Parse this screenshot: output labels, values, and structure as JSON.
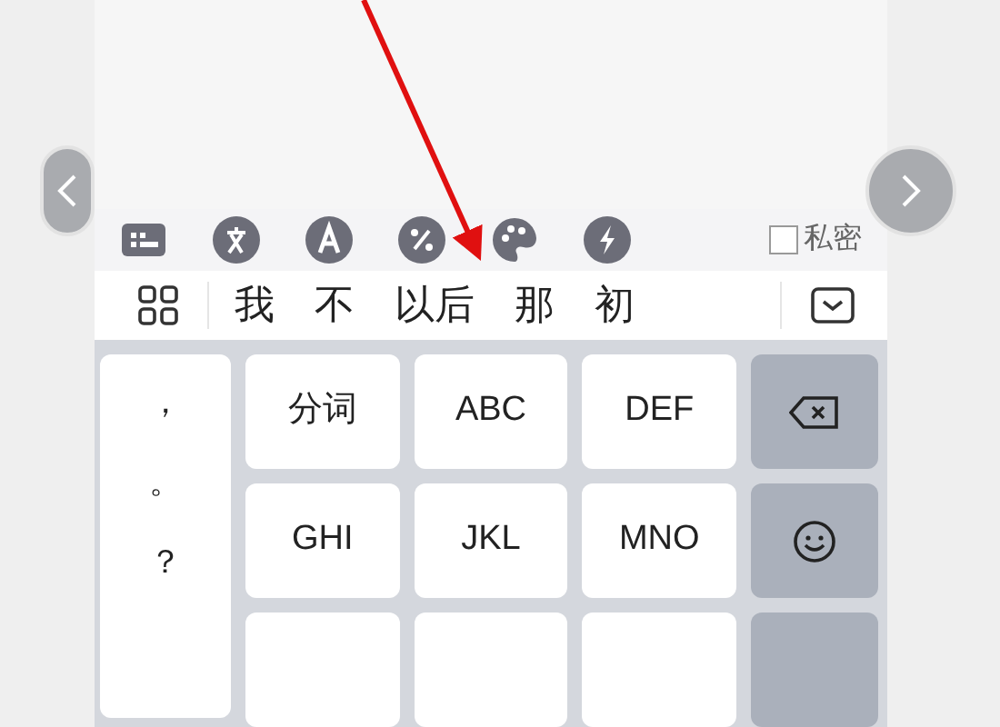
{
  "toolbar": {
    "private_mode": {
      "label": "私密",
      "checked": false
    }
  },
  "candidates": [
    "我",
    "不",
    "以后",
    "那",
    "初"
  ],
  "punctuation": [
    "，",
    "。",
    "？"
  ],
  "keys": [
    [
      "分词",
      "ABC",
      "DEF"
    ],
    [
      "GHI",
      "JKL",
      "MNO"
    ]
  ]
}
